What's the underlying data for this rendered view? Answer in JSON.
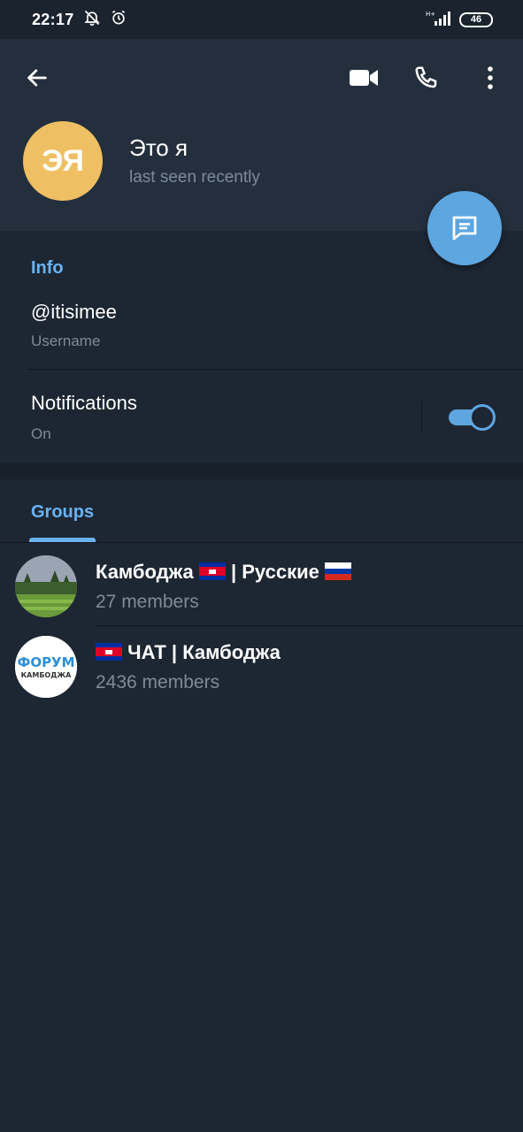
{
  "status_bar": {
    "time": "22:17",
    "network": "H+",
    "battery": "46"
  },
  "header": {
    "avatar_initials": "ЭЯ",
    "name": "Это я",
    "status": "last seen recently"
  },
  "info": {
    "section_title": "Info",
    "username": "@itisimee",
    "username_label": "Username",
    "notifications_label": "Notifications",
    "notifications_state": "On"
  },
  "groups": {
    "tab_label": "Groups",
    "items": [
      {
        "title_a": "Камбоджа",
        "title_b": "| Русские",
        "members": "27 members"
      },
      {
        "title_a": "ЧАТ | Камбоджа",
        "members": "2436 members",
        "avatar_text_top": "ФОРУМ",
        "avatar_text_bottom": "КАМБОДЖА"
      }
    ]
  },
  "colors": {
    "accent": "#6ab2f2",
    "fab": "#5ea6e0",
    "avatar": "#eebf63",
    "header_bg": "#242f3d",
    "body_bg": "#1d2733"
  }
}
